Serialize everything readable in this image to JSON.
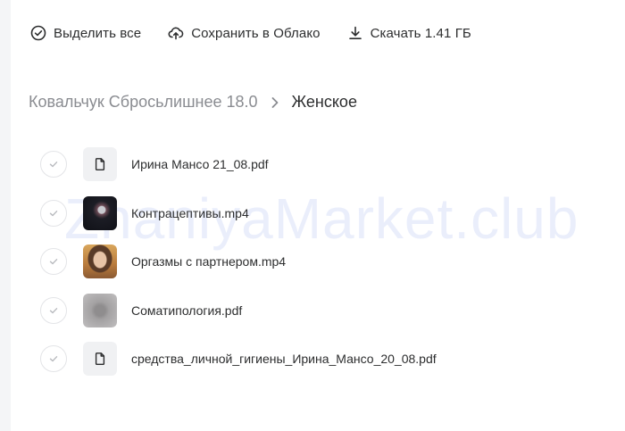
{
  "toolbar": {
    "select_all_label": "Выделить все",
    "save_cloud_label": "Сохранить в Облако",
    "download_label": "Скачать 1.41 ГБ"
  },
  "breadcrumb": {
    "parent": "Ковальчук Сбросьлишнее 18.0",
    "current": "Женское"
  },
  "files": [
    {
      "name": "Ирина Мансо 21_08.pdf",
      "thumb": "document-icon"
    },
    {
      "name": "Контрацептивы.mp4",
      "thumb": "video-thumbnail"
    },
    {
      "name": "Оргазмы с партнером.mp4",
      "thumb": "video-thumbnail"
    },
    {
      "name": "Соматипология.pdf",
      "thumb": "pdf-thumbnail"
    },
    {
      "name": "средства_личной_гигиены_Ирина_Мансо_20_08.pdf",
      "thumb": "document-icon"
    }
  ],
  "watermark": "ZnaniyaMarket.club",
  "colors": {
    "text_primary": "#2c2d2e",
    "text_secondary": "#8a8c91",
    "watermark": "#e7ecfb"
  }
}
